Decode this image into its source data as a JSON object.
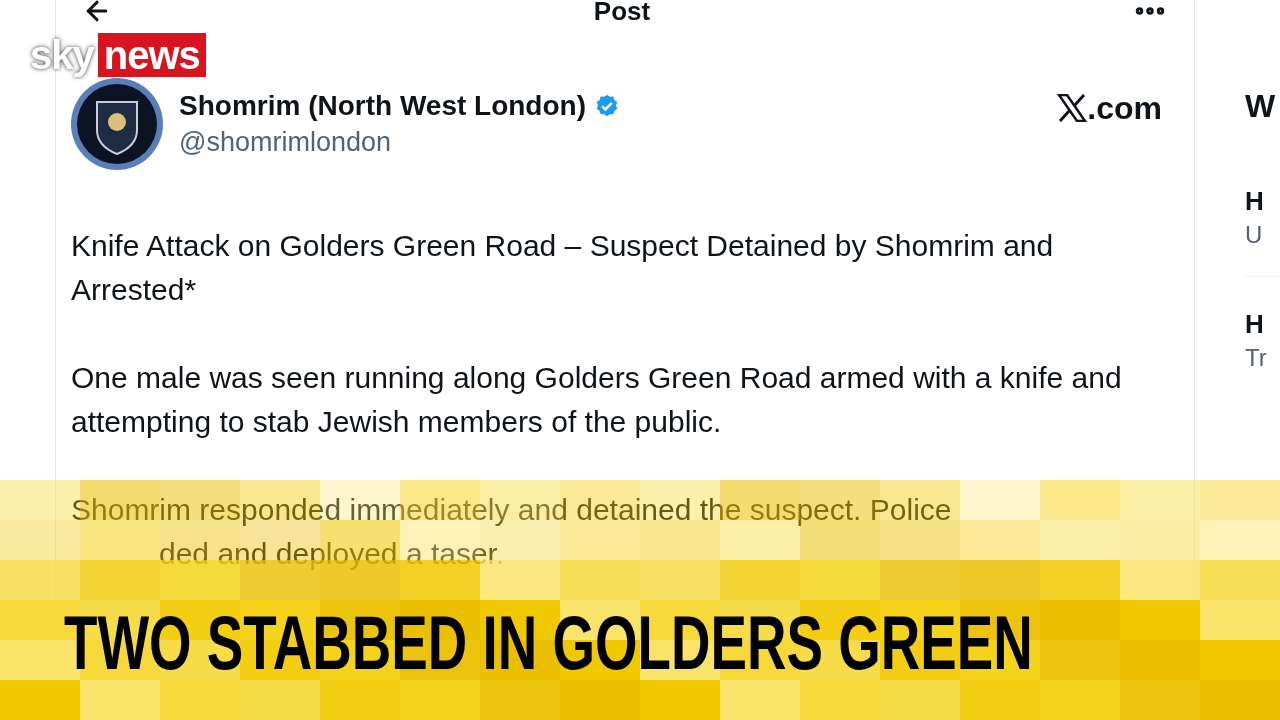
{
  "broadcast": {
    "channel_logo": {
      "sky": "sky",
      "news": "news"
    },
    "headline": "TWO STABBED IN GOLDERS GREEN"
  },
  "post_view": {
    "title": "Post"
  },
  "post": {
    "author": {
      "name": "Shomrim (North West London)",
      "handle": "@shomrimlondon",
      "verified": true
    },
    "source": ".com",
    "paragraphs": [
      {
        "text": "Knife Attack on Golders Green Road – Suspect Detained by Shomrim and Arrested*"
      },
      {
        "text": "One male was seen running along Golders Green Road armed with a knife and attempting to stab Jewish members of the public."
      },
      {
        "text": "Shomrim responded immediately and detained the suspect. Police"
      },
      {
        "text": "ded and deployed a taser."
      }
    ]
  },
  "sidebar": {
    "items": [
      {
        "kind": "heading",
        "text": "W"
      },
      {
        "kind": "title",
        "text": "H"
      },
      {
        "kind": "subtitle",
        "text": "U"
      },
      {
        "kind": "title",
        "text": "H"
      },
      {
        "kind": "subtitle",
        "text": "Tr"
      }
    ]
  }
}
